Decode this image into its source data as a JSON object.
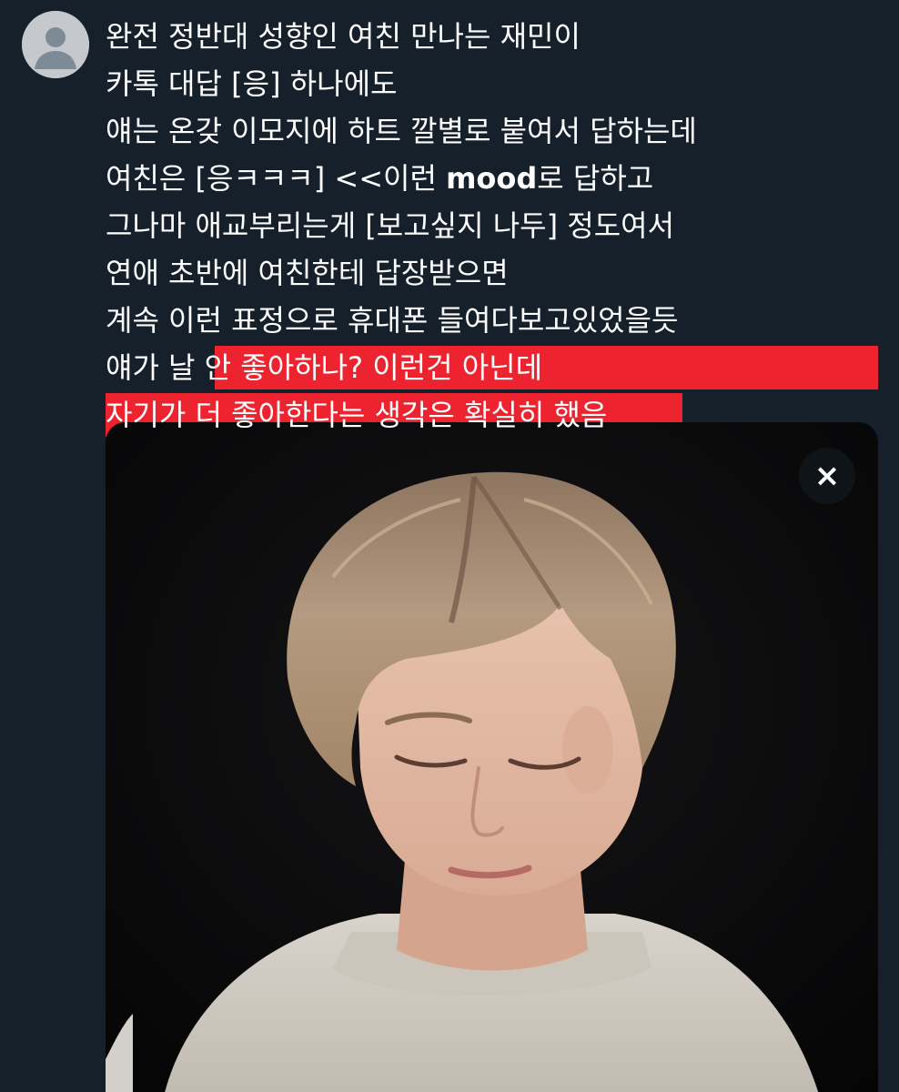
{
  "tweet": {
    "lines": [
      "완전 정반대 성향인 여친 만나는 재민이",
      "카톡 대답 [응] 하나에도",
      "얘는 온갖 이모지에 하트 깔별로 붙여서 답하는데",
      "그나마 애교부리는게 [보고싶지 나두] 정도여서",
      "연애 초반에 여친한테 답장받으면",
      "계속 이런 표정으로 휴대폰 들여다보고있었을듯"
    ],
    "line4_part1": "여친은 [응ㅋㅋㅋ] <<이런 ",
    "line4_bold": "mood",
    "line4_part2": "로 답하고",
    "line9_plain": "얘가 날 ",
    "line9_highlight": "안 좋아하나? 이런건 아닌데",
    "line10_highlight": "자기가 더 좋아한다는 생각은 확실히 했음"
  },
  "media": {
    "close_icon": "×",
    "subject": "photo"
  },
  "colors": {
    "background": "#15202b",
    "highlight": "#ee2330",
    "text": "#ffffff"
  }
}
